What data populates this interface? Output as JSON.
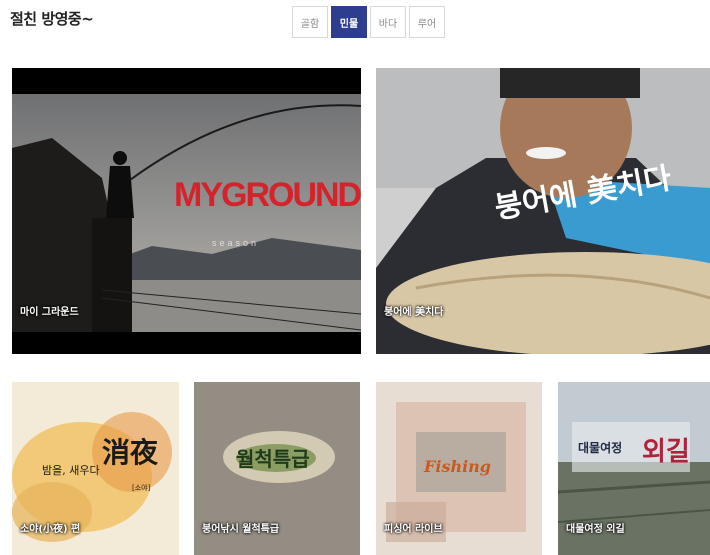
{
  "header": {
    "title": "절친 방영중~"
  },
  "tabs": [
    {
      "label": "골함",
      "active": false
    },
    {
      "label": "민물",
      "active": true
    },
    {
      "label": "바다",
      "active": false
    },
    {
      "label": "루어",
      "active": false
    }
  ],
  "cards": [
    {
      "caption": "마이 그라운드",
      "logo": "MYGROUND",
      "logo_sub": "season"
    },
    {
      "caption": "붕어에 美치다",
      "logo": "붕어에 美치다"
    },
    {
      "caption": "소야(小夜) 편",
      "logo_main": "消夜",
      "logo_side": "밤을, 새우다",
      "logo_tag": "[소야]"
    },
    {
      "caption": "붕어낚시 월척특급",
      "logo": "월척특급"
    },
    {
      "caption": "피싱어 라이브",
      "logo": "Fishing"
    },
    {
      "caption": "대물여정 외길",
      "logo_small": "대물여정",
      "logo_big": "외길"
    }
  ]
}
